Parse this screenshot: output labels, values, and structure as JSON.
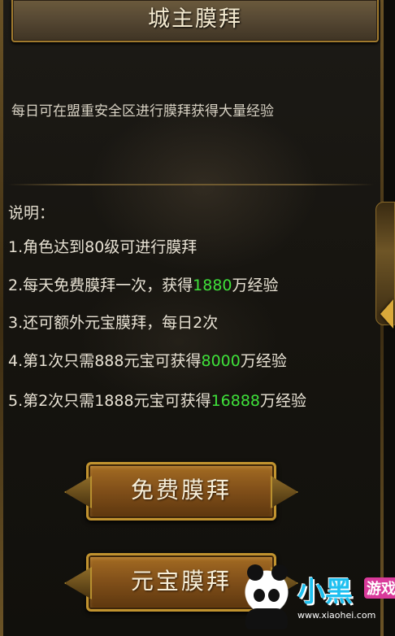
{
  "header": {
    "title": "城主膜拜"
  },
  "intro": "每日可在盟重安全区进行膜拜获得大量经验",
  "description": {
    "title": "说明：",
    "rules": [
      {
        "prefix": "1.角色达到80级可进行膜拜",
        "value": "",
        "suffix": ""
      },
      {
        "prefix": "2.每天免费膜拜一次，获得",
        "value": "1880",
        "suffix": "万经验"
      },
      {
        "prefix": "3.还可额外元宝膜拜，每日2次",
        "value": "",
        "suffix": ""
      },
      {
        "prefix": "4.第1次只需888元宝可获得",
        "value": "8000",
        "suffix": "万经验"
      },
      {
        "prefix": "5.第2次只需1888元宝可获得",
        "value": "16888",
        "suffix": "万经验"
      }
    ]
  },
  "buttons": {
    "free_worship": "免费膜拜",
    "ingot_worship": "元宝膜拜"
  },
  "watermark": {
    "name": "小黑游戏",
    "main": "小黑",
    "badge": "游戏",
    "url": "www.xiaohei.com"
  },
  "colors": {
    "highlight": "#3fe03a",
    "title_text": "#f4ead0",
    "button_gold": "#c1932f",
    "body_text": "#e8e2d4"
  },
  "icons": {
    "collapse": "chevron-left-icon"
  }
}
